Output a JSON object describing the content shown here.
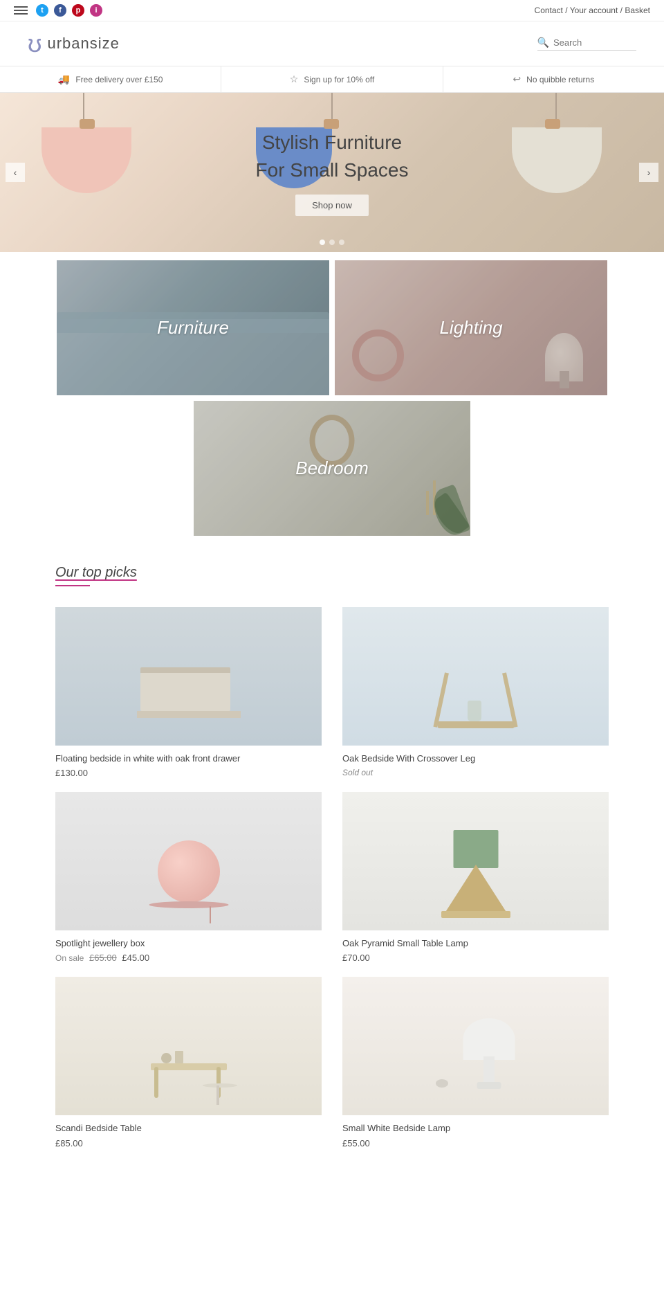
{
  "topbar": {
    "social": [
      "Twitter",
      "Facebook",
      "Pinterest",
      "Instagram"
    ],
    "nav": "Contact / Your account / Basket"
  },
  "header": {
    "logo": "urbansize",
    "search_placeholder": "Search"
  },
  "infobar": [
    {
      "icon": "truck-icon",
      "text": "Free delivery over £150"
    },
    {
      "icon": "star-icon",
      "text": "Sign up for 10% off"
    },
    {
      "icon": "return-icon",
      "text": "No quibble returns"
    }
  ],
  "hero": {
    "title": "Stylish Furniture\nFor Small Spaces",
    "cta": "Shop now",
    "dots": [
      true,
      false,
      false
    ]
  },
  "categories": [
    {
      "label": "Furniture",
      "key": "furniture"
    },
    {
      "label": "Lighting",
      "key": "lighting"
    },
    {
      "label": "Bedroom",
      "key": "bedroom"
    }
  ],
  "top_picks": {
    "section_title": "Our top picks",
    "products": [
      {
        "name": "Floating bedside in white with oak front drawer",
        "price": "£130.00",
        "status": "",
        "img_class": "img-bedside1"
      },
      {
        "name": "Oak Bedside With Crossover Leg",
        "price": "",
        "status": "Sold out",
        "img_class": "img-bedside2"
      },
      {
        "name": "Spotlight jewellery box",
        "price": "",
        "status": "on-sale",
        "sale_label": "On sale",
        "original_price": "£65.00",
        "sale_price": "£45.00",
        "img_class": "img-jewellery"
      },
      {
        "name": "Oak Pyramid Small Table Lamp",
        "price": "£70.00",
        "status": "",
        "img_class": "img-lamp"
      },
      {
        "name": "Scandi Bedside Table",
        "price": "£85.00",
        "status": "",
        "img_class": "img-nightstand"
      },
      {
        "name": "Small White Bedside Lamp",
        "price": "£55.00",
        "status": "",
        "img_class": "img-lamp2"
      }
    ]
  }
}
